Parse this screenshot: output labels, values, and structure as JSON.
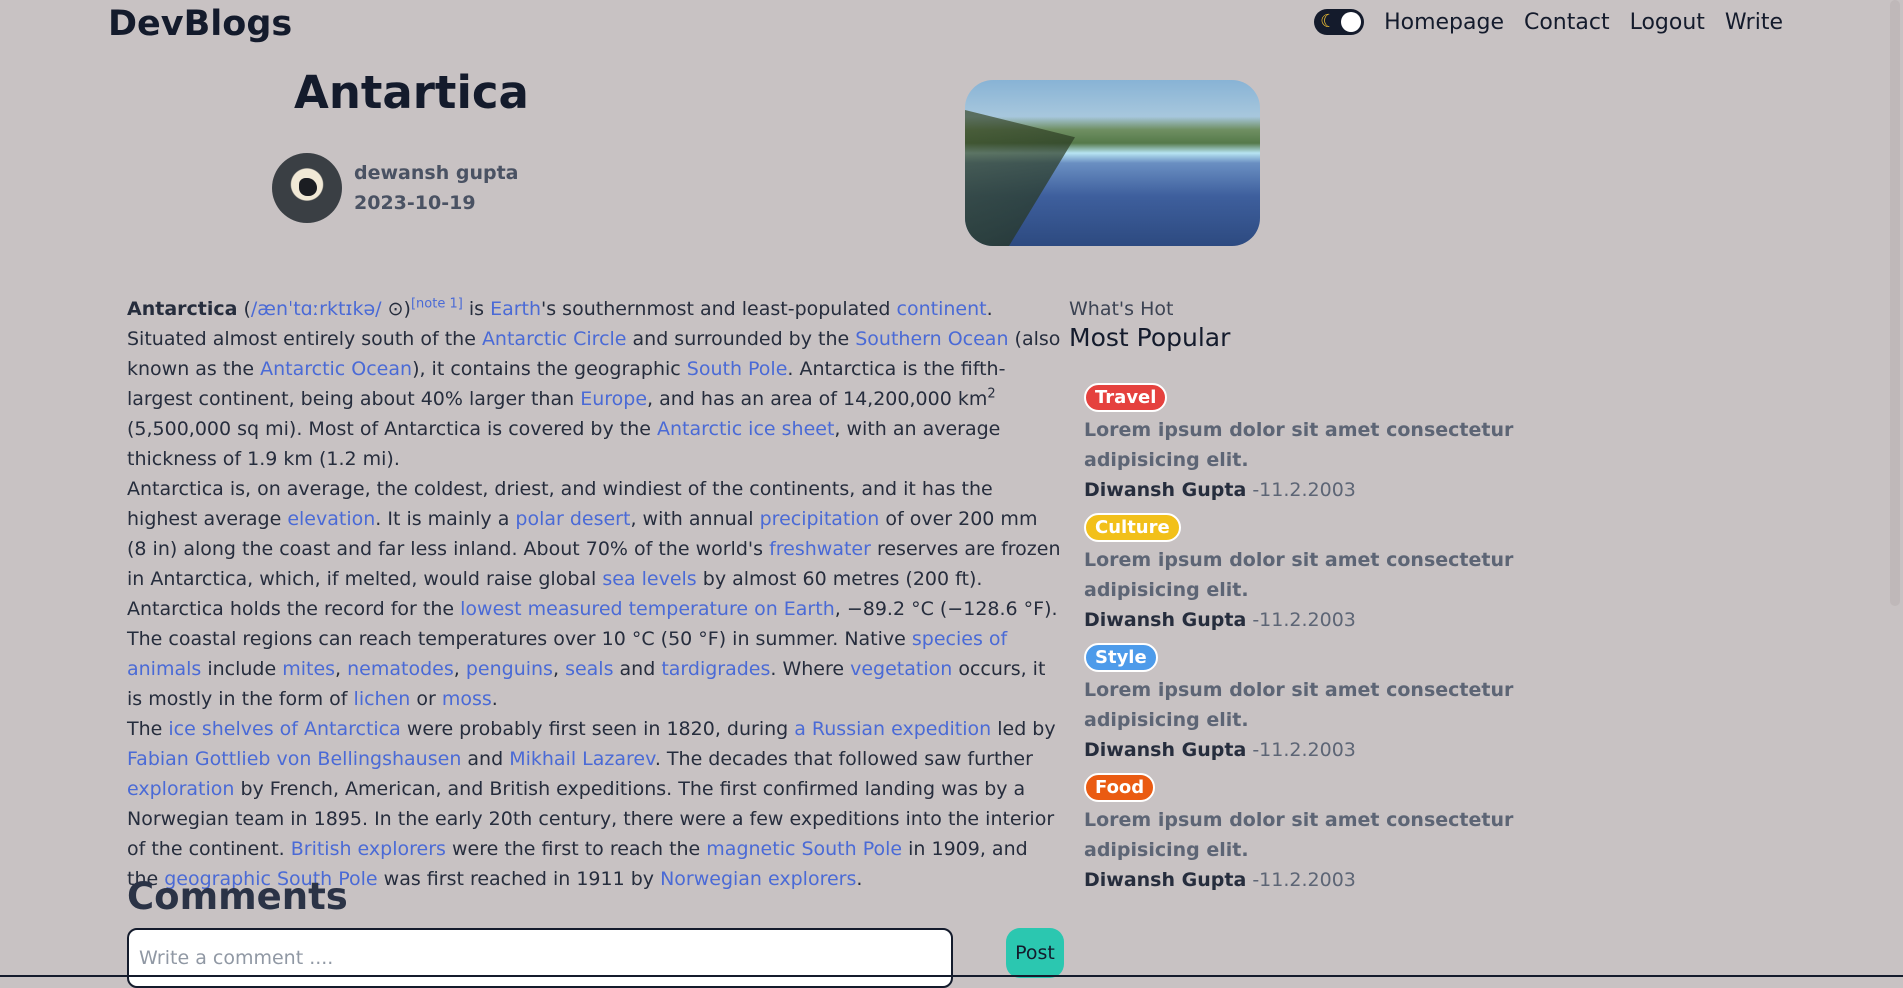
{
  "header": {
    "logo": "DevBlogs",
    "nav": [
      "Homepage",
      "Contact",
      "Logout",
      "Write"
    ]
  },
  "post": {
    "title": "Antartica",
    "author": "dewansh gupta",
    "date": "2023-10-19"
  },
  "article": {
    "p1": [
      {
        "t": "Antarctica",
        "b": true
      },
      {
        "t": " ("
      },
      {
        "t": "/ænˈtɑːrktɪkə/",
        "l": true
      },
      {
        "t": " ⊙"
      },
      {
        "t": ")"
      },
      {
        "t": "[note 1]",
        "l": true,
        "sup": true
      },
      {
        "t": " is "
      },
      {
        "t": "Earth",
        "l": true
      },
      {
        "t": "'s southernmost and least-populated "
      },
      {
        "t": "continent",
        "l": true
      },
      {
        "t": ". Situated almost entirely south of the "
      },
      {
        "t": "Antarctic Circle",
        "l": true
      },
      {
        "t": " and surrounded by the "
      },
      {
        "t": "Southern Ocean",
        "l": true
      },
      {
        "t": " (also known as the "
      },
      {
        "t": "Antarctic Ocean",
        "l": true
      },
      {
        "t": "), it contains the geographic "
      },
      {
        "t": "South Pole",
        "l": true
      },
      {
        "t": ". Antarctica is the fifth-largest continent, being about 40% larger than "
      },
      {
        "t": "Europe",
        "l": true
      },
      {
        "t": ", and has an area of 14,200,000 km"
      },
      {
        "t": "2",
        "sup": true
      },
      {
        "t": " (5,500,000 sq mi). Most of Antarctica is covered by the "
      },
      {
        "t": "Antarctic ice sheet",
        "l": true
      },
      {
        "t": ", with an average thickness of 1.9 km (1.2 mi)."
      }
    ],
    "p2": [
      {
        "t": "Antarctica is, on average, the coldest, driest, and windiest of the continents, and it has the highest average "
      },
      {
        "t": "elevation",
        "l": true
      },
      {
        "t": ". It is mainly a "
      },
      {
        "t": "polar desert",
        "l": true
      },
      {
        "t": ", with annual "
      },
      {
        "t": "precipitation",
        "l": true
      },
      {
        "t": " of over 200 mm (8 in) along the coast and far less inland. About 70% of the world's "
      },
      {
        "t": "freshwater",
        "l": true
      },
      {
        "t": " reserves are frozen in Antarctica, which, if melted, would raise global "
      },
      {
        "t": "sea levels",
        "l": true
      },
      {
        "t": " by almost 60 metres (200 ft). Antarctica holds the record for the "
      },
      {
        "t": "lowest measured temperature on Earth",
        "l": true
      },
      {
        "t": ", −89.2 °C (−128.6 °F). The coastal regions can reach temperatures over 10 °C (50 °F) in summer. Native "
      },
      {
        "t": "species of animals",
        "l": true
      },
      {
        "t": " include "
      },
      {
        "t": "mites",
        "l": true
      },
      {
        "t": ", "
      },
      {
        "t": "nematodes",
        "l": true
      },
      {
        "t": ", "
      },
      {
        "t": "penguins",
        "l": true
      },
      {
        "t": ", "
      },
      {
        "t": "seals",
        "l": true
      },
      {
        "t": " and "
      },
      {
        "t": "tardigrades",
        "l": true
      },
      {
        "t": ". Where "
      },
      {
        "t": "vegetation",
        "l": true
      },
      {
        "t": " occurs, it is mostly in the form of "
      },
      {
        "t": "lichen",
        "l": true
      },
      {
        "t": " or "
      },
      {
        "t": "moss",
        "l": true
      },
      {
        "t": "."
      }
    ],
    "p3": [
      {
        "t": "The "
      },
      {
        "t": "ice shelves of Antarctica",
        "l": true
      },
      {
        "t": " were probably first seen in 1820, during "
      },
      {
        "t": "a Russian expedition",
        "l": true
      },
      {
        "t": " led by "
      },
      {
        "t": "Fabian Gottlieb von Bellingshausen",
        "l": true
      },
      {
        "t": " and "
      },
      {
        "t": "Mikhail Lazarev",
        "l": true
      },
      {
        "t": ". The decades that followed saw further "
      },
      {
        "t": "exploration",
        "l": true
      },
      {
        "t": " by French, American, and British expeditions. The first confirmed landing was by a Norwegian team in 1895. In the early 20th century, there were a few expeditions into the interior of the continent. "
      },
      {
        "t": "British explorers",
        "l": true
      },
      {
        "t": " were the first to reach the "
      },
      {
        "t": "magnetic South Pole",
        "l": true
      },
      {
        "t": " in 1909, and the "
      },
      {
        "t": "geographic South Pole",
        "l": true
      },
      {
        "t": " was first reached in 1911 by "
      },
      {
        "t": "Norwegian explorers",
        "l": true
      },
      {
        "t": "."
      }
    ]
  },
  "comments": {
    "heading": "Comments",
    "placeholder": "Write a comment ....",
    "post_label": "Post"
  },
  "sidebar": {
    "kicker": "What's Hot",
    "heading": "Most Popular",
    "items": [
      {
        "category": "Travel",
        "color": "#e5413e",
        "text": "Lorem ipsum dolor sit amet consectetur adipisicing elit.",
        "author": "Diwansh Gupta",
        "date": "-11.2.2003"
      },
      {
        "category": "Culture",
        "color": "#f2c01a",
        "text": "Lorem ipsum dolor sit amet consectetur adipisicing elit.",
        "author": "Diwansh Gupta",
        "date": "-11.2.2003"
      },
      {
        "category": "Style",
        "color": "#4d9bea",
        "text": "Lorem ipsum dolor sit amet consectetur adipisicing elit.",
        "author": "Diwansh Gupta",
        "date": "-11.2.2003"
      },
      {
        "category": "Food",
        "color": "#ea5b12",
        "text": "Lorem ipsum dolor sit amet consectetur adipisicing elit.",
        "author": "Diwansh Gupta",
        "date": "-11.2.2003"
      }
    ]
  }
}
